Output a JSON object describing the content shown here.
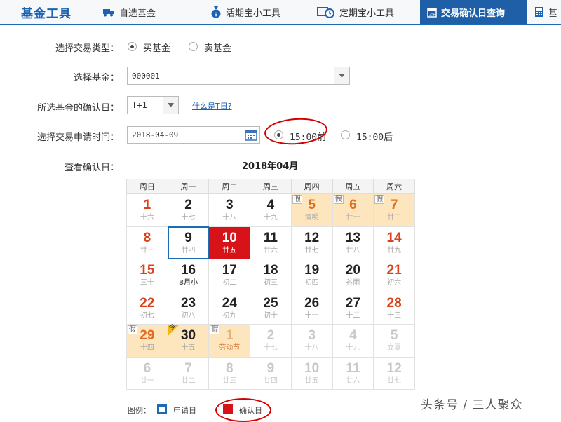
{
  "nav": {
    "brand": "基金工具",
    "tabs": [
      {
        "label": "自选基金",
        "icon": "truck-icon"
      },
      {
        "label": "活期宝小工具",
        "icon": "money-bag-icon"
      },
      {
        "label": "定期宝小工具",
        "icon": "timer-icon"
      },
      {
        "label": "交易确认日查询",
        "icon": "calendar-icon"
      },
      {
        "label": "基",
        "icon": "calculator-icon"
      }
    ],
    "active_tab": "交易确认日查询",
    "accent_color": "#1e5fa8"
  },
  "form": {
    "trade_type_label": "选择交易类型：",
    "trade_type_options": [
      "买基金",
      "卖基金"
    ],
    "trade_type_selected": "买基金",
    "fund_label": "选择基金：",
    "fund_value": "000001",
    "confirm_label": "所选基金的确认日：",
    "confirm_value": "T+1",
    "what_is_t_link": "什么是T日?",
    "apply_time_label": "选择交易申请时间：",
    "apply_date": "2018-04-09",
    "time_options": [
      "15:00前",
      "15:00后"
    ],
    "time_selected": "15:00前",
    "view_label": "查看确认日："
  },
  "calendar": {
    "title": "2018年04月",
    "weekdays": [
      "周日",
      "周一",
      "周二",
      "周三",
      "周四",
      "周五",
      "周六"
    ],
    "holiday_tag": "假",
    "today_tag": "今",
    "weeks": [
      [
        {
          "d": "1",
          "l": "十六",
          "t": "we"
        },
        {
          "d": "2",
          "l": "十七"
        },
        {
          "d": "3",
          "l": "十八"
        },
        {
          "d": "4",
          "l": "十九"
        },
        {
          "d": "5",
          "l": "清明",
          "t": "hol"
        },
        {
          "d": "6",
          "l": "廿一",
          "t": "hol"
        },
        {
          "d": "7",
          "l": "廿二",
          "t": "hol"
        }
      ],
      [
        {
          "d": "8",
          "l": "廿三",
          "t": "we"
        },
        {
          "d": "9",
          "l": "廿四",
          "t": "apply"
        },
        {
          "d": "10",
          "l": "廿五",
          "t": "confirm"
        },
        {
          "d": "11",
          "l": "廿六"
        },
        {
          "d": "12",
          "l": "廿七"
        },
        {
          "d": "13",
          "l": "廿八"
        },
        {
          "d": "14",
          "l": "廿九",
          "t": "we"
        }
      ],
      [
        {
          "d": "15",
          "l": "三十",
          "t": "we"
        },
        {
          "d": "16",
          "l": "3月小",
          "t": "bold"
        },
        {
          "d": "17",
          "l": "初二"
        },
        {
          "d": "18",
          "l": "初三"
        },
        {
          "d": "19",
          "l": "初四"
        },
        {
          "d": "20",
          "l": "谷雨"
        },
        {
          "d": "21",
          "l": "初六",
          "t": "we"
        }
      ],
      [
        {
          "d": "22",
          "l": "初七",
          "t": "we"
        },
        {
          "d": "23",
          "l": "初八"
        },
        {
          "d": "24",
          "l": "初九"
        },
        {
          "d": "25",
          "l": "初十"
        },
        {
          "d": "26",
          "l": "十一"
        },
        {
          "d": "27",
          "l": "十二"
        },
        {
          "d": "28",
          "l": "十三",
          "t": "we"
        }
      ],
      [
        {
          "d": "29",
          "l": "十四",
          "t": "hol"
        },
        {
          "d": "30",
          "l": "十五",
          "t": "today"
        },
        {
          "d": "1",
          "l": "劳动节",
          "t": "hol2"
        },
        {
          "d": "2",
          "l": "十七",
          "t": "grey"
        },
        {
          "d": "3",
          "l": "十八",
          "t": "grey"
        },
        {
          "d": "4",
          "l": "十九",
          "t": "grey"
        },
        {
          "d": "5",
          "l": "立夏",
          "t": "grey"
        }
      ],
      [
        {
          "d": "6",
          "l": "廿一",
          "t": "grey"
        },
        {
          "d": "7",
          "l": "廿二",
          "t": "grey"
        },
        {
          "d": "8",
          "l": "廿三",
          "t": "grey"
        },
        {
          "d": "9",
          "l": "廿四",
          "t": "grey"
        },
        {
          "d": "10",
          "l": "廿五",
          "t": "grey"
        },
        {
          "d": "11",
          "l": "廿六",
          "t": "grey"
        },
        {
          "d": "12",
          "l": "廿七",
          "t": "grey"
        }
      ]
    ]
  },
  "legend": {
    "label": "图例：",
    "apply": "申请日",
    "confirm": "确认日",
    "apply_color": "#1b6cb5",
    "confirm_color": "#d71219"
  },
  "watermark": "头条号 / 三人聚众"
}
